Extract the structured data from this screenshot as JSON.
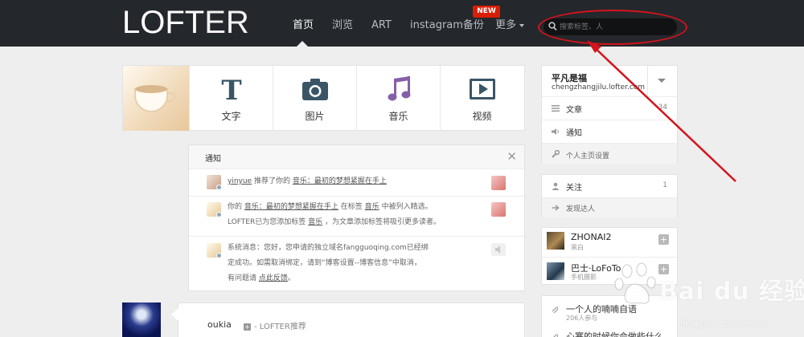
{
  "header": {
    "logo": {
      "bold": "LOFT",
      "thin": "ER"
    },
    "nav": [
      {
        "label": "首页",
        "active": true
      },
      {
        "label": "浏览"
      },
      {
        "label": "ART"
      },
      {
        "label": "instagram备份"
      },
      {
        "label": "更多"
      }
    ],
    "new_badge": "NEW",
    "search": {
      "placeholder": "搜索标签、人"
    }
  },
  "publish": {
    "items": [
      {
        "label": "文字",
        "icon": "text-icon"
      },
      {
        "label": "图片",
        "icon": "camera-icon"
      },
      {
        "label": "音乐",
        "icon": "music-note-icon"
      },
      {
        "label": "视频",
        "icon": "video-play-icon"
      }
    ]
  },
  "notice": {
    "title": "通知",
    "close": "✕",
    "row1": {
      "user": "yinyue",
      "text1": "推荐了你的",
      "link": "音乐：最初的梦想紧握在手上"
    },
    "row2": {
      "text1": "你的",
      "link1": "音乐：最初的梦想紧握在手上",
      "text2": "在标签",
      "link2": "音乐",
      "text3": "中被列入精选。",
      "text4": "LOFTER已为您添加标签",
      "link3": "音乐",
      "text5": "，为文章添加标签将吸引更多读者。"
    },
    "row3": {
      "line1": "系统消息：您好，您申请的独立域名fangguoqing.com已经绑",
      "line2": "定成功。如需取消绑定，请到“博客设置--博客信息”中取消，",
      "line3_text": "有问题请",
      "line3_link": "点此反馈",
      "line3_end": "。"
    }
  },
  "feed": {
    "user": "oukia",
    "tag": "- LOFTER推荐"
  },
  "sidebar": {
    "profile": {
      "name": "平凡是福",
      "url": "chengzhangjilu.lofter.com"
    },
    "menu": [
      {
        "label": "文章",
        "count": "34",
        "icon": "list-icon"
      },
      {
        "label": "通知",
        "count": "",
        "icon": "speaker-icon"
      },
      {
        "label": "个人主页设置",
        "count": "",
        "icon": "wrench-icon"
      }
    ],
    "social": [
      {
        "label": "关注",
        "count": "1",
        "icon": "person-icon"
      },
      {
        "label": "发现达人",
        "count": "",
        "icon": "arrow-right-icon"
      }
    ],
    "recommend": [
      {
        "name": "ZHONAI2",
        "sub": "黑白"
      },
      {
        "name": "巴士·LoFoTo",
        "sub": "手机摄影"
      }
    ],
    "tags": [
      {
        "title": "一个人的喃喃自语",
        "sub": "206人参与"
      },
      {
        "title": "心寒的时候你会做些什么",
        "sub": ""
      }
    ]
  },
  "watermark": {
    "text": "Bai du 经验",
    "url": "jingyan.baidu.com"
  },
  "colors": {
    "topbar": "#24272b",
    "new_badge": "#d81e06",
    "annotation": "#d4141c",
    "icon": "#3a5566"
  }
}
